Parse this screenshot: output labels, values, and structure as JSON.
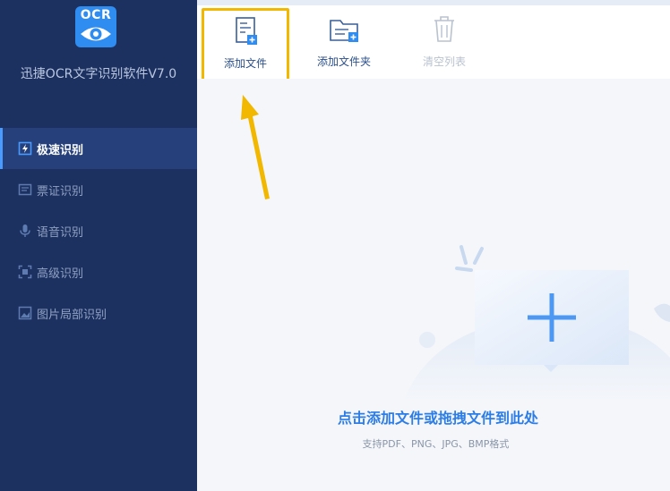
{
  "app": {
    "logo_text": "OCR",
    "name": "迅捷OCR文字识别软件V7.0"
  },
  "sidebar": {
    "items": [
      {
        "label": "极速识别",
        "icon": "fast-recognize-icon",
        "active": true
      },
      {
        "label": "票证识别",
        "icon": "ticket-icon",
        "active": false
      },
      {
        "label": "语音识别",
        "icon": "microphone-icon",
        "active": false
      },
      {
        "label": "高级识别",
        "icon": "scan-frame-icon",
        "active": false
      },
      {
        "label": "图片局部识别",
        "icon": "image-crop-icon",
        "active": false
      }
    ]
  },
  "toolbar": {
    "add_file_label": "添加文件",
    "add_folder_label": "添加文件夹",
    "clear_list_label": "清空列表"
  },
  "dropzone": {
    "title": "点击添加文件或拖拽文件到此处",
    "subtitle": "支持PDF、PNG、JPG、BMP格式"
  },
  "colors": {
    "sidebar_bg": "#1c3160",
    "accent": "#2f8cf0",
    "highlight_border": "#f2b800",
    "arrow": "#f2b800"
  }
}
